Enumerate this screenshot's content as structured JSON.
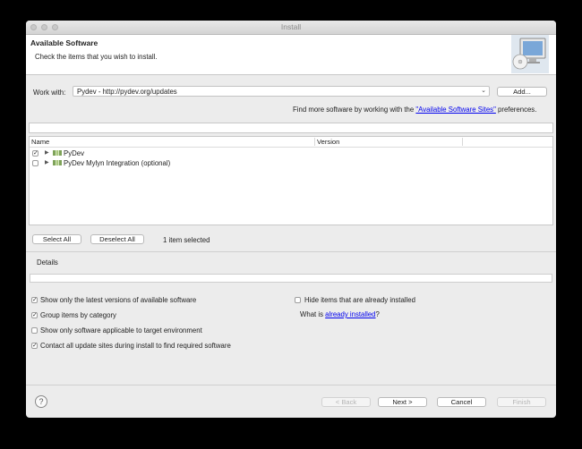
{
  "window": {
    "title": "Install"
  },
  "header": {
    "title": "Available Software",
    "description": "Check the items that you wish to install."
  },
  "work_with": {
    "label": "Work with:",
    "value": "Pydev - http://pydev.org/updates",
    "add_label": "Add..."
  },
  "find_more": {
    "prefix": "Find more software by working with the ",
    "link": "\"Available Software Sites\"",
    "suffix": " preferences."
  },
  "filter": {
    "value": ""
  },
  "tree": {
    "columns": [
      "Name",
      "Version"
    ],
    "rows": [
      {
        "label": "PyDev",
        "checked": true
      },
      {
        "label": "PyDev Mylyn Integration (optional)",
        "checked": false
      }
    ]
  },
  "selection": {
    "select_all": "Select All",
    "deselect_all": "Deselect All",
    "status": "1 item selected"
  },
  "details": {
    "label": "Details"
  },
  "options": {
    "latest_versions": {
      "label": "Show only the latest versions of available software",
      "checked": true
    },
    "group_by_category": {
      "label": "Group items by category",
      "checked": true
    },
    "applicable_only": {
      "label": "Show only software applicable to target environment",
      "checked": false
    },
    "contact_sites": {
      "label": "Contact all update sites during install to find required software",
      "checked": true
    },
    "hide_installed": {
      "label": "Hide items that are already installed",
      "checked": false
    },
    "what_is": {
      "prefix": "What is ",
      "link": "already installed",
      "suffix": "?"
    }
  },
  "footer": {
    "help_icon": "question-mark-icon",
    "back": "< Back",
    "next": "Next >",
    "cancel": "Cancel",
    "finish": "Finish"
  }
}
